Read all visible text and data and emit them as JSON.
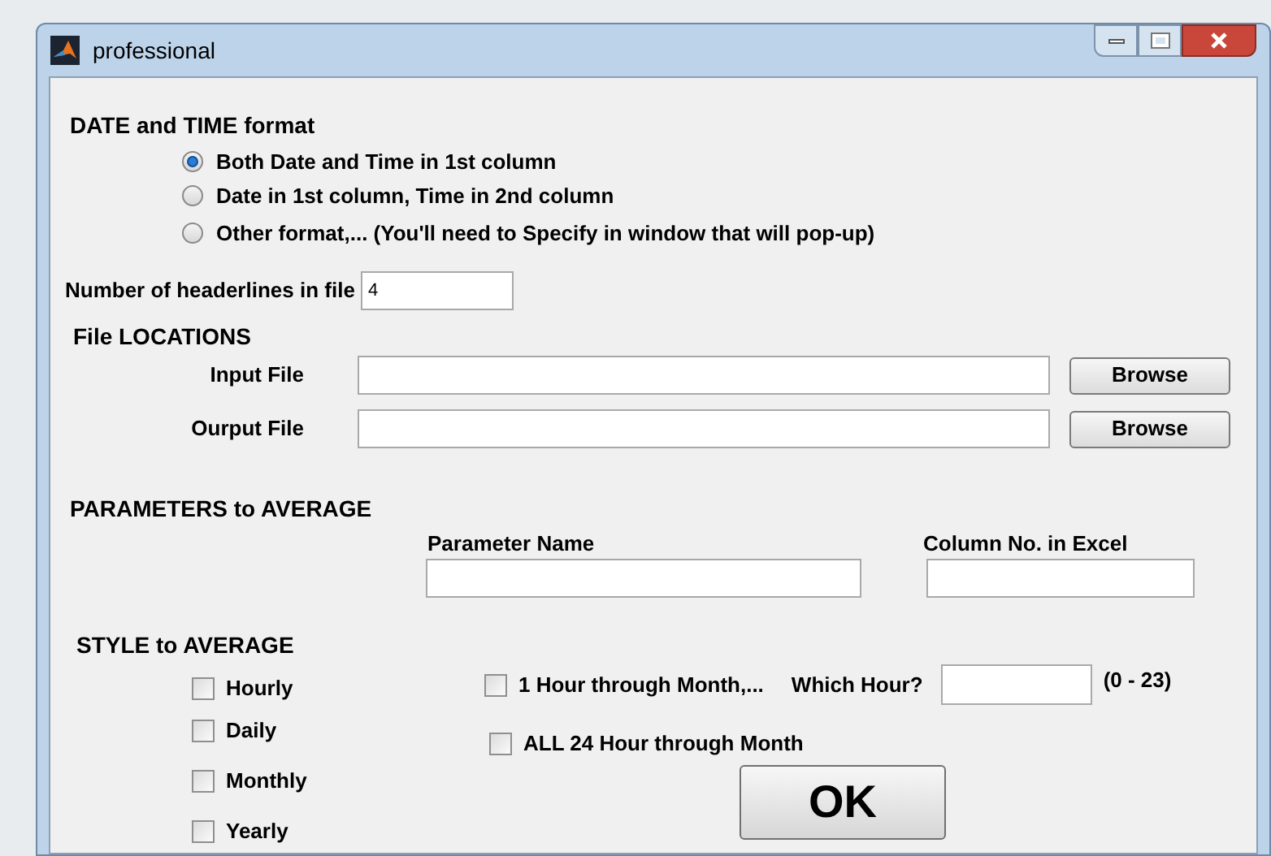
{
  "window": {
    "title": "professional"
  },
  "date_time": {
    "heading": "DATE and TIME format",
    "options": [
      {
        "label": "Both Date and Time in 1st column",
        "selected": true
      },
      {
        "label": "Date in 1st column, Time in 2nd column",
        "selected": false
      },
      {
        "label": "Other format,... (You'll need to Specify in window that will pop-up)",
        "selected": false
      }
    ]
  },
  "headerlines": {
    "label": "Number of headerlines in file",
    "value": "4"
  },
  "files": {
    "heading": "File LOCATIONS",
    "rows": [
      {
        "label": "Input File",
        "button": "Browse"
      },
      {
        "label": "Ourput File",
        "button": "Browse"
      }
    ]
  },
  "parameters": {
    "heading": "PARAMETERS to AVERAGE",
    "columns": [
      "Parameter Name",
      "Column No. in Excel"
    ]
  },
  "style": {
    "heading": "STYLE to AVERAGE",
    "periods": [
      {
        "label": "Hourly",
        "checked": false
      },
      {
        "label": "Daily",
        "checked": false
      },
      {
        "label": "Monthly",
        "checked": false
      },
      {
        "label": "Yearly",
        "checked": false
      }
    ],
    "hour_option": {
      "label": "1 Hour through Month,...",
      "checked": false,
      "field_label": "Which Hour?",
      "range": "(0 - 23)"
    },
    "all_hours": {
      "label": "ALL 24 Hour through Month",
      "checked": false
    }
  },
  "ok_button": "OK"
}
